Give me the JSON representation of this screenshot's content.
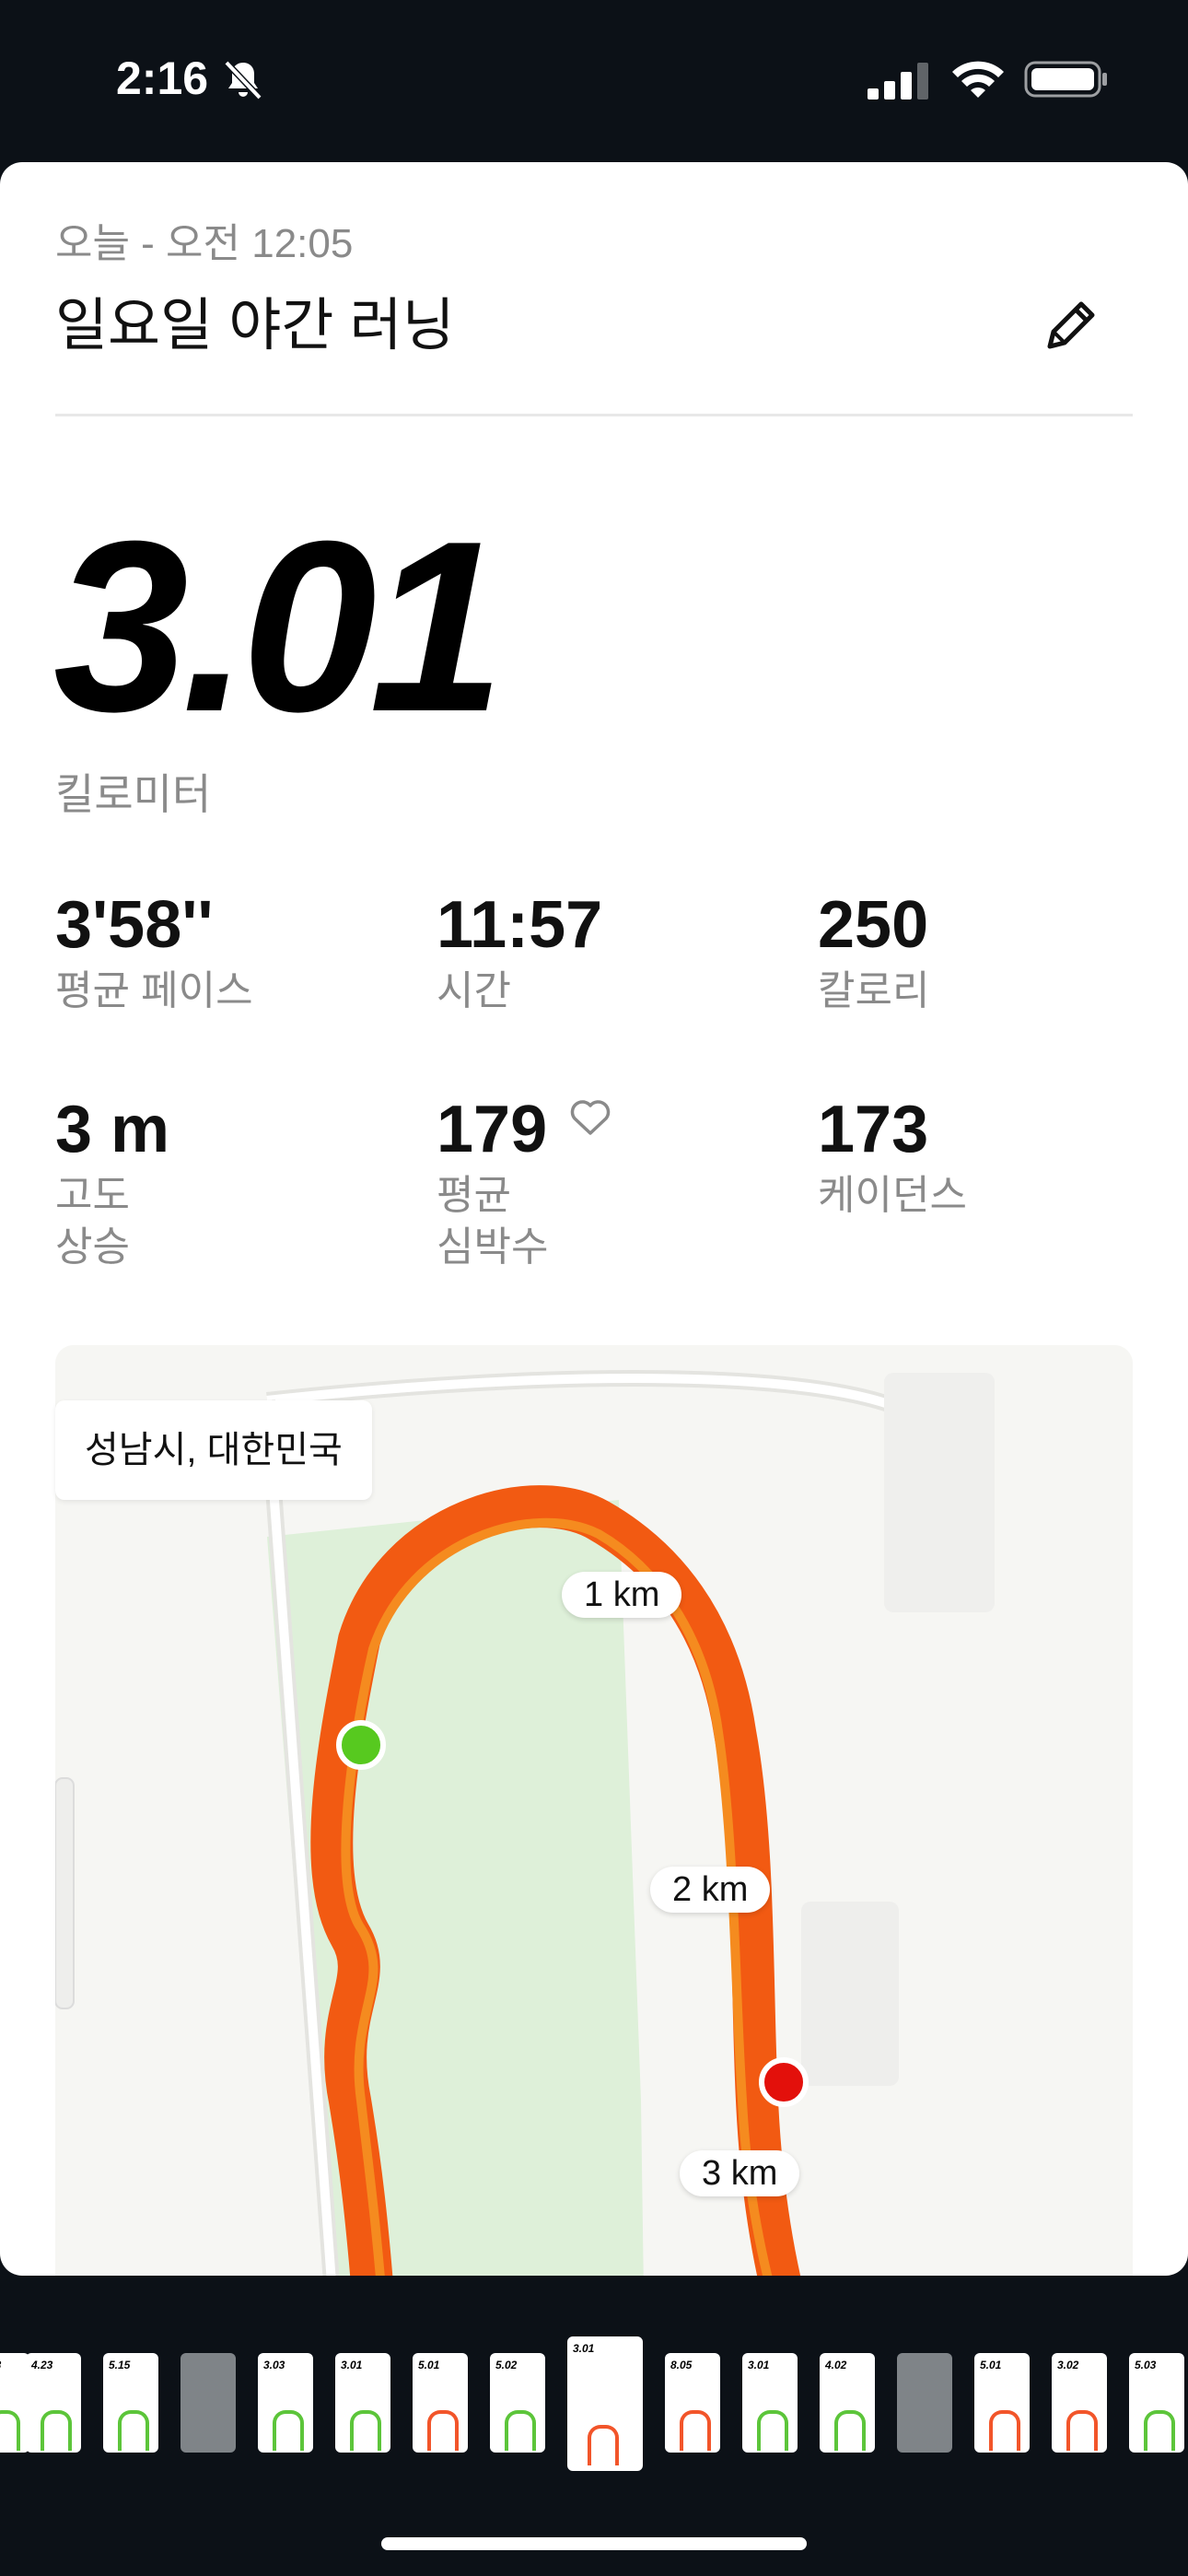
{
  "status": {
    "time": "2:16",
    "silent_icon": "bell-slash-icon",
    "signal_icon": "signal-icon",
    "wifi_icon": "wifi-icon",
    "battery_icon": "battery-icon"
  },
  "activity": {
    "date": "오늘 - 오전 12:05",
    "title": "일요일 야간 러닝",
    "edit_icon": "pencil-icon",
    "distance": "3.01",
    "distance_unit": "킬로미터"
  },
  "stats": [
    {
      "value": "3'58''",
      "label": "평균 페이스"
    },
    {
      "value": "11:57",
      "label": "시간"
    },
    {
      "value": "250",
      "label": "칼로리"
    },
    {
      "value": "3 m",
      "label_line1": "고도",
      "label_line2": "상승"
    },
    {
      "value": "179",
      "label_line1": "평균",
      "label_line2": "심박수",
      "icon": "heart-icon"
    },
    {
      "value": "173",
      "label": "케이던스"
    }
  ],
  "map": {
    "location": "성남시, 대한민국",
    "markers": [
      "1 km",
      "2 km",
      "3 km"
    ],
    "start_color": "#57c91f",
    "end_color": "#e3100b",
    "route_color": "#f5520f"
  },
  "filmstrip": [
    {
      "label": "4.23"
    },
    {
      "label": "5.15"
    },
    {
      "label": ""
    },
    {
      "label": "3.03"
    },
    {
      "label": "3.01"
    },
    {
      "label": "5.01"
    },
    {
      "label": "5.02"
    },
    {
      "label": "3.01"
    },
    {
      "label": "8.05"
    },
    {
      "label": "3.01"
    },
    {
      "label": "4.02"
    },
    {
      "label": ""
    },
    {
      "label": "5.01"
    },
    {
      "label": "3.02"
    },
    {
      "label": "5.03"
    }
  ]
}
